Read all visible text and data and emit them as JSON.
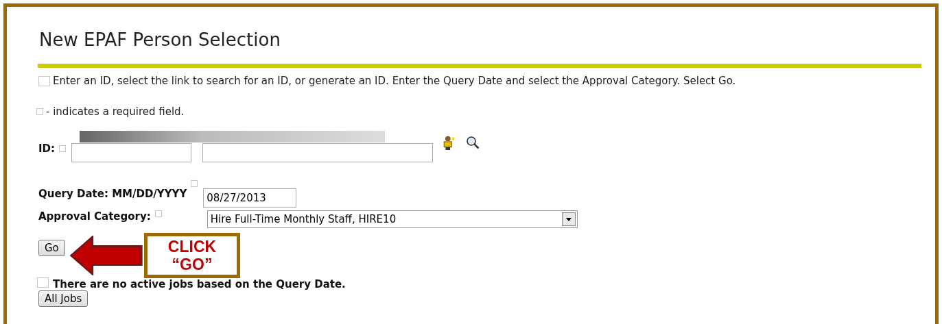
{
  "title": "New EPAF Person Selection",
  "instructions": "Enter an ID, select the link to search for an ID, or generate an ID. Enter the Query Date and select the Approval Category. Select Go.",
  "required_note": "- indicates a required field.",
  "id_field": {
    "label": "ID:"
  },
  "query_date": {
    "label": "Query Date: MM/DD/YYYY",
    "value": "08/27/2013"
  },
  "approval_category": {
    "label": "Approval Category:",
    "value": "Hire Full-Time Monthly Staff, HIRE10"
  },
  "go_button": "Go",
  "message": "There are no active jobs based on the Query Date.",
  "all_jobs_button": "All Jobs",
  "callout": [
    "CLICK",
    "“GO”"
  ]
}
